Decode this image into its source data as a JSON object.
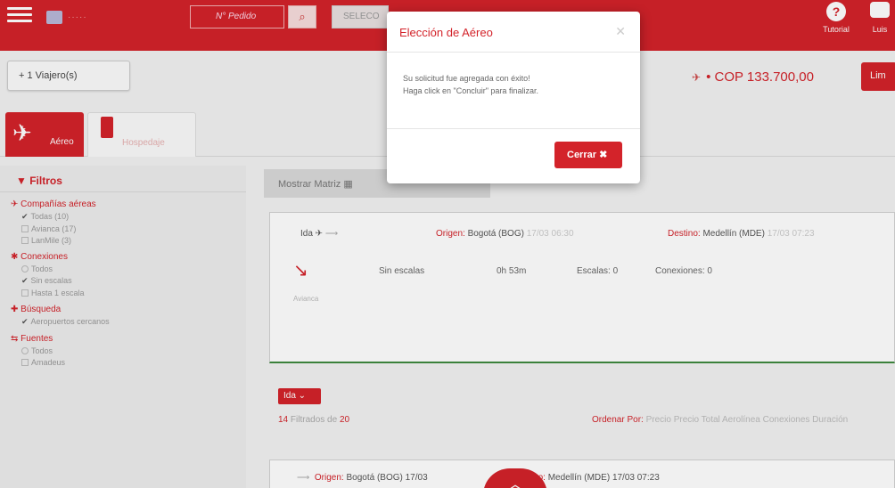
{
  "header": {
    "order_placeholder": "N° Pedido",
    "select_value": "SELECO",
    "tutorial_label": "Tutorial",
    "user_label": "Luis"
  },
  "toolbar": {
    "travelers_label": "+ 1 Viajero(s)",
    "total_price": "• COP 133.700,00",
    "right_button": "Lim"
  },
  "product_tabs": [
    {
      "label": "Aéreo",
      "icon": "plane-icon",
      "active": true
    },
    {
      "label": "Hospedaje",
      "icon": "building-icon",
      "active": false
    }
  ],
  "sidebar": {
    "title": "Filtros",
    "groups": [
      {
        "title": "Compañías aéreas",
        "options": [
          "Todas (10)",
          "Avianca (17)",
          "LanMile (3)"
        ]
      },
      {
        "title": "Conexiones",
        "options": [
          "Todos",
          "Sin escalas",
          "Hasta 1 escala"
        ]
      },
      {
        "title": "Búsqueda",
        "options": [
          "Aeropuertos cercanos"
        ]
      },
      {
        "title": "Fuentes",
        "options": [
          "Todos",
          "Amadeus"
        ]
      }
    ]
  },
  "main": {
    "matrix_button": "Mostrar Matriz",
    "flight": {
      "direction": "Ida",
      "origin_label": "Origen:",
      "origin_value": "Bogotá (BOG)",
      "origin_time": "17/03 06:30",
      "destination_label": "Destino:",
      "destination_value": "Medellín (MDE)",
      "destination_time": "17/03 07:23",
      "airline": "Avianca",
      "stops": "Sin escalas",
      "duration": "0h 53m",
      "escalas": "Escalas: 0",
      "conexiones": "Conexiones: 0"
    },
    "ida_badge": "Ida",
    "filtered_count": "14",
    "filtered_text": "Filtrados de",
    "total_count": "20",
    "sort_label": "Ordenar Por:",
    "sort_options": "Precio  Precio Total  Aerolínea  Conexiones  Duración",
    "second_flight": {
      "origin_label": "Origen:",
      "origin_value": "Bogotá (BOG)",
      "origin_time": "17/03",
      "destination_label": "Destino:",
      "destination_value": "Medellín (MDE)",
      "destination_time": "17/03 07:23"
    }
  },
  "modal": {
    "title": "Elección de Aéreo",
    "message_line1": "Su solicitud fue agregada con éxito!",
    "message_line2": "Haga click en \"Concluir\" para finalizar.",
    "close_button": "Cerrar ✖"
  },
  "colors": {
    "brand_red": "#d3232a",
    "success_green": "#3f8a3f"
  }
}
